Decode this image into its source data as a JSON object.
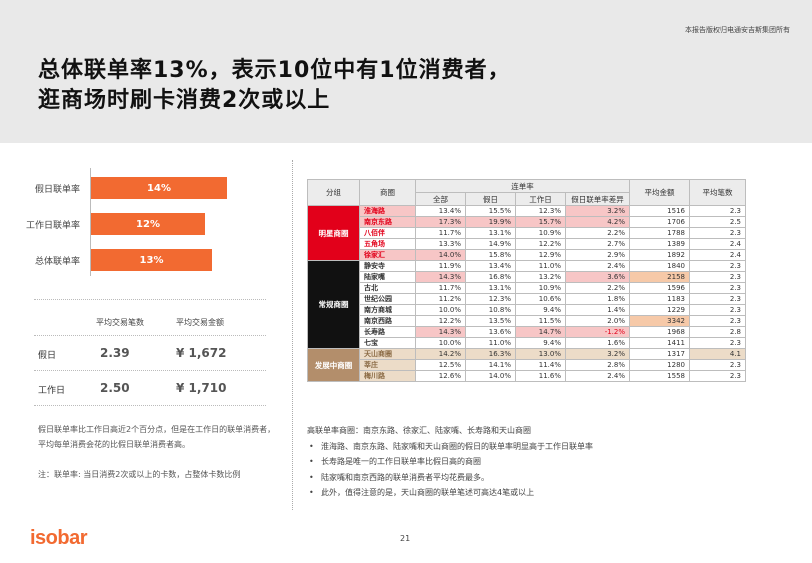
{
  "copyright": "本报告版权归电通安吉斯集团所有",
  "title_line1": "总体联单率13%，表示10位中有1位消费者，",
  "title_line2": "逛商场时刷卡消费2次或以上",
  "bars": [
    {
      "label": "假日联单率",
      "value_label": "14%",
      "value": 14
    },
    {
      "label": "工作日联单率",
      "value_label": "12%",
      "value": 12
    },
    {
      "label": "总体联单率",
      "value_label": "13%",
      "value": 13
    }
  ],
  "stats": {
    "col1": "平均交易笔数",
    "col2": "平均交易金额",
    "rows": [
      {
        "label": "假日",
        "count": "2.39",
        "amount": "¥ 1,672"
      },
      {
        "label": "工作日",
        "count": "2.50",
        "amount": "¥ 1,710"
      }
    ]
  },
  "note1": "假日联单率比工作日高近2个百分点，但是在工作日的联单消费者，平均每单消费会花的比假日联单消费者高。",
  "note2": "注：联单率: 当日消费2次或以上的卡数，占整体卡数比例",
  "table": {
    "h_group": "分组",
    "h_mall": "商圈",
    "h_rate": "连单率",
    "h_all": "全部",
    "h_holiday": "假日",
    "h_workday": "工作日",
    "h_diff": "假日联单率差异",
    "h_amount": "平均金额",
    "h_count": "平均笔数",
    "groups": [
      {
        "name": "明星商圈",
        "rows": [
          [
            "淮海路",
            "13.4%",
            "15.5%",
            "12.3%",
            "3.2%",
            "1516",
            "2.3"
          ],
          [
            "南京东路",
            "17.3%",
            "19.9%",
            "15.7%",
            "4.2%",
            "1706",
            "2.5"
          ],
          [
            "八佰伴",
            "11.7%",
            "13.1%",
            "10.9%",
            "2.2%",
            "1788",
            "2.3"
          ],
          [
            "五角场",
            "13.3%",
            "14.9%",
            "12.2%",
            "2.7%",
            "1389",
            "2.4"
          ],
          [
            "徐家汇",
            "14.0%",
            "15.8%",
            "12.9%",
            "2.9%",
            "1892",
            "2.4"
          ]
        ]
      },
      {
        "name": "常规商圈",
        "rows": [
          [
            "静安寺",
            "11.9%",
            "13.4%",
            "11.0%",
            "2.4%",
            "1840",
            "2.3"
          ],
          [
            "陆家嘴",
            "14.3%",
            "16.8%",
            "13.2%",
            "3.6%",
            "2158",
            "2.3"
          ],
          [
            "古北",
            "11.7%",
            "13.1%",
            "10.9%",
            "2.2%",
            "1596",
            "2.3"
          ],
          [
            "世纪公园",
            "11.2%",
            "12.3%",
            "10.6%",
            "1.8%",
            "1183",
            "2.3"
          ],
          [
            "南方商城",
            "10.0%",
            "10.8%",
            "9.4%",
            "1.4%",
            "1229",
            "2.3"
          ],
          [
            "南京西路",
            "12.2%",
            "13.5%",
            "11.5%",
            "2.0%",
            "3342",
            "2.3"
          ],
          [
            "长寿路",
            "14.3%",
            "13.6%",
            "14.7%",
            "-1.2%",
            "1968",
            "2.8"
          ],
          [
            "七宝",
            "10.0%",
            "11.0%",
            "9.4%",
            "1.6%",
            "1411",
            "2.3"
          ]
        ]
      },
      {
        "name": "发展中商圈",
        "rows": [
          [
            "天山商圈",
            "14.2%",
            "16.3%",
            "13.0%",
            "3.2%",
            "1317",
            "4.1"
          ],
          [
            "莘庄",
            "12.5%",
            "14.1%",
            "11.4%",
            "2.8%",
            "1280",
            "2.3"
          ],
          [
            "梅川路",
            "12.6%",
            "14.0%",
            "11.6%",
            "2.4%",
            "1558",
            "2.3"
          ]
        ]
      }
    ]
  },
  "bullets": {
    "intro": "高联单率商圈：南京东路、徐家汇、陆家嘴、长寿路和天山商圈",
    "items": [
      "淮海路、南京东路、陆家嘴和天山商圈的假日的联单率明显高于工作日联单率",
      "长寿路是唯一的工作日联单率比假日高的商圈",
      "陆家嘴和南京西路的联单消费者平均花费最多。",
      "此外，值得注意的是，天山商圈的联单笔述可高达4笔或以上"
    ]
  },
  "logo": "isobar",
  "page_number": "21",
  "colors": {
    "accent": "#f26a31",
    "star": "#e2001a",
    "regular": "#111111",
    "developing": "#b38e6b"
  }
}
